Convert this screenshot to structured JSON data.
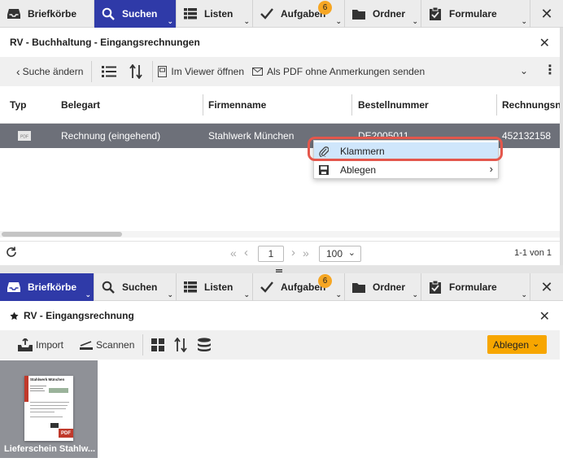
{
  "nav": {
    "items": [
      {
        "label": "Briefkörbe",
        "icon": "inbox-tray-icon",
        "active": false
      },
      {
        "label": "Suchen",
        "icon": "search-icon",
        "active": true
      },
      {
        "label": "Listen",
        "icon": "list-icon",
        "active": false
      },
      {
        "label": "Aufgaben",
        "icon": "checkmark-icon",
        "active": false,
        "badge": "6"
      },
      {
        "label": "Ordner",
        "icon": "folder-icon",
        "active": false
      },
      {
        "label": "Formulare",
        "icon": "clipboard-check-icon",
        "active": false
      }
    ],
    "close_glyph": "✕"
  },
  "search_panel": {
    "title": "RV - Buchhaltung - Eingangsrechnungen",
    "close_glyph": "✕",
    "toolbar": {
      "back_label": "Suche ändern",
      "open_viewer_label": "Im Viewer öffnen",
      "send_pdf_label": "Als PDF ohne Anmerkungen senden"
    },
    "columns": [
      "Typ",
      "Belegart",
      "Firmenname",
      "Bestellnummer",
      "Rechnungsnu"
    ],
    "rows": [
      {
        "type_icon": "pdf-file-icon",
        "type_label": "PDF",
        "belegart": "Rechnung (eingehend)",
        "firmenname": "Stahlwerk München",
        "bestellnummer": "DE2005011",
        "rechnungsnummer": "452132158"
      }
    ],
    "context_menu": {
      "items": [
        {
          "label": "Klammern",
          "icon": "paperclip-icon",
          "highlighted": true
        },
        {
          "label": "Ablegen",
          "icon": "save-icon",
          "submenu": true
        }
      ]
    },
    "pager": {
      "page": "1",
      "page_size": "100",
      "summary": "1-1 von 1"
    }
  },
  "tray_panel": {
    "nav_active": "Briefkörbe",
    "title": "RV - Eingangsrechnung",
    "close_glyph": "✕",
    "toolbar": {
      "import_label": "Import",
      "scan_label": "Scannen",
      "file_button_label": "Ablegen"
    },
    "documents": [
      {
        "name": "Lieferschein Stahlw...",
        "thumbnail_header": "Stahlwerk München",
        "badge": "PDF"
      }
    ]
  },
  "colors": {
    "nav_active": "#2f3aa8",
    "row_selected": "#6d7079",
    "menu_highlight": "#cfe6fb",
    "callout_ring": "#e4574c",
    "accent_orange": "#f6a623",
    "file_button": "#f7a600"
  }
}
